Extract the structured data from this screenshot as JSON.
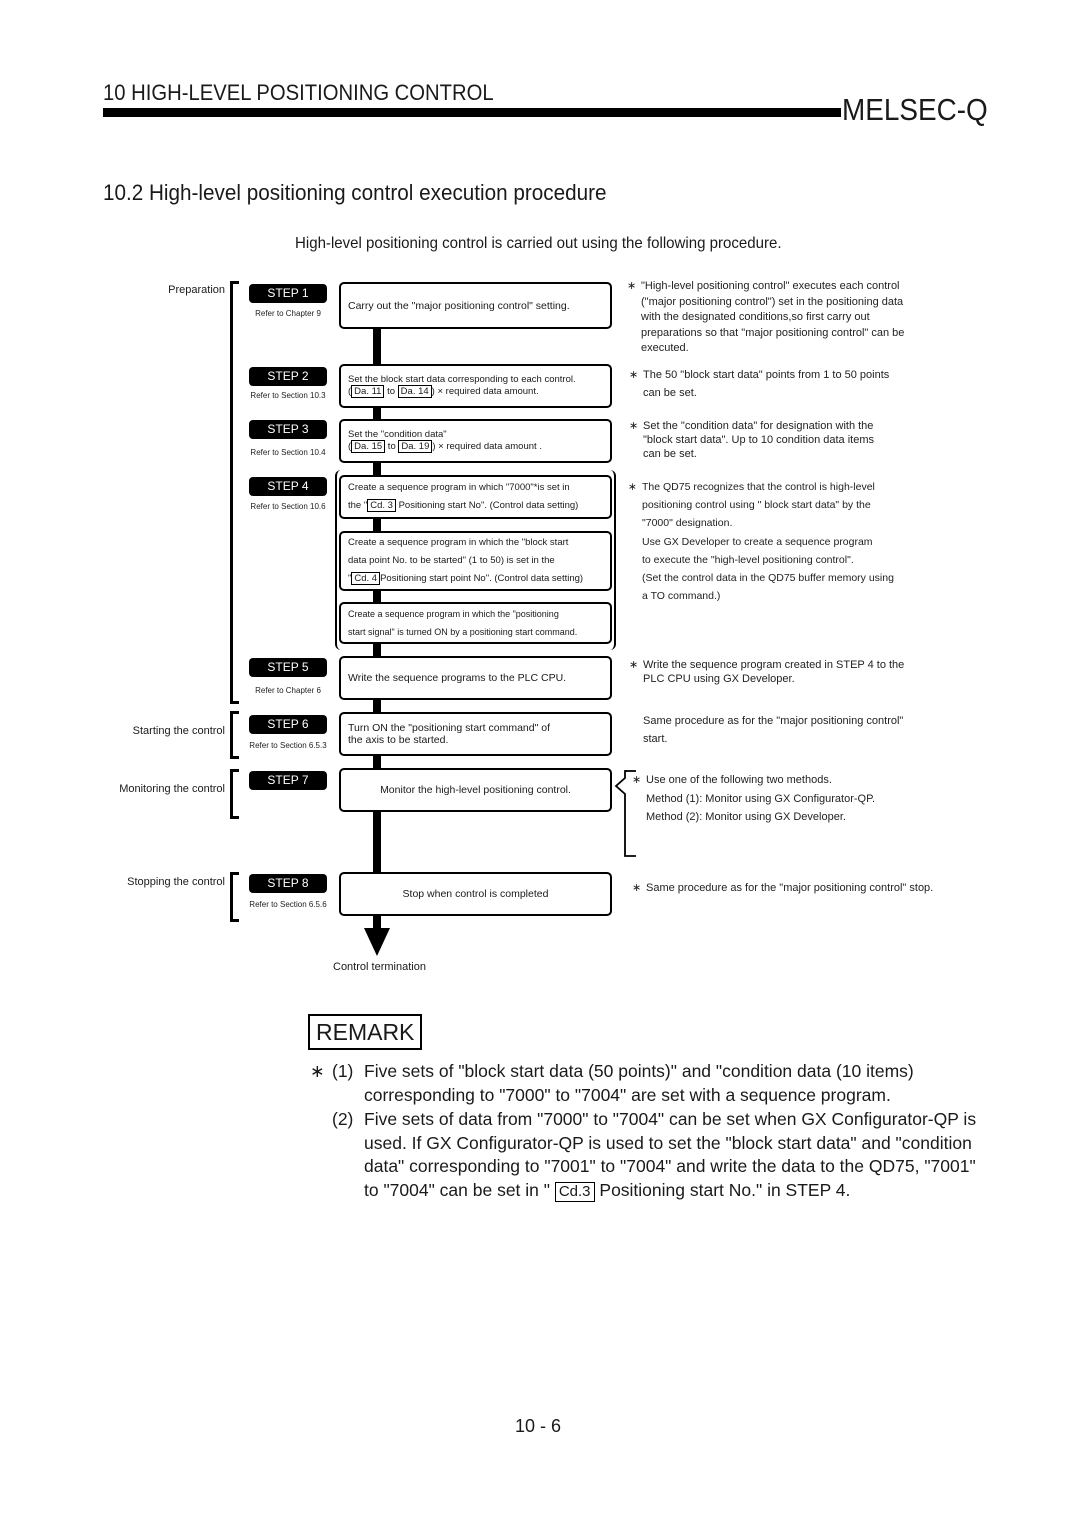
{
  "header": {
    "chapter_title": "10  HIGH-LEVEL POSITIONING CONTROL",
    "brand": "MELSEC-Q"
  },
  "section": {
    "title": "10.2 High-level positioning control execution procedure",
    "intro": "High-level positioning control is carried out using the following procedure."
  },
  "phases": {
    "preparation": "Preparation",
    "starting": "Starting the control",
    "monitoring": "Monitoring the control",
    "stopping": "Stopping the control"
  },
  "steps": [
    {
      "label": "STEP 1",
      "ref": "Refer to Chapter 9"
    },
    {
      "label": "STEP 2",
      "ref": "Refer to Section 10.3"
    },
    {
      "label": "STEP 3",
      "ref": "Refer to Section 10.4"
    },
    {
      "label": "STEP 4",
      "ref": "Refer to Section 10.6"
    },
    {
      "label": "STEP 5",
      "ref": "Refer to Chapter 6"
    },
    {
      "label": "STEP 6",
      "ref": "Refer to Section 6.5.3"
    },
    {
      "label": "STEP 7",
      "ref": ""
    },
    {
      "label": "STEP 8",
      "ref": "Refer to Section 6.5.6"
    }
  ],
  "boxes": {
    "step1": "Carry out the \"major positioning control\" setting.",
    "step2_line1": "Set the block start data corresponding to each control.",
    "step2_open": "(",
    "step2_tag_a": "Da. 11",
    "step2_to": " to ",
    "step2_tag_b": "Da. 14",
    "step2_tail": ") × required data amount.",
    "step3_line1": "Set the \"condition data\"",
    "step3_open": "(",
    "step3_tag_a": "Da. 15",
    "step3_to": " to ",
    "step3_tag_b": "Da. 19",
    "step3_tail": ") × required data amount .",
    "step4a_line1": "Create a sequence program in which \"7000\"*is set in",
    "step4a_pre": "the \"",
    "step4a_tag": "Cd. 3",
    "step4a_tail": " Positioning start No\". (Control data setting)",
    "step4b_line1": "Create a sequence program in which the \"block start",
    "step4b_line2": "data point No. to be started\" (1 to 50) is set in the",
    "step4b_pre": "\"",
    "step4b_tag": "Cd. 4",
    "step4b_tail": "Positioning start point No\". (Control data setting)",
    "step4c_line1": "Create a sequence program in which the \"positioning",
    "step4c_line2": "start signal\" is turned ON by a positioning start command.",
    "step5": "Write the sequence programs to the PLC CPU.",
    "step6_line1": "Turn ON the \"positioning start command\" of",
    "step6_line2": "the axis to be started.",
    "step7": "Monitor the high-level positioning control.",
    "step8": "Stop when control is completed",
    "termination": "Control termination"
  },
  "notes": {
    "asterisk": "∗",
    "n1": [
      "\"High-level positioning control\" executes each control",
      "(\"major positioning control\") set in the positioning data",
      "with the designated conditions,so first carry out",
      "preparations so that \"major positioning control\" can be",
      "executed."
    ],
    "n2": [
      "The 50 \"block start  data\" points from 1 to 50 points",
      "can be set."
    ],
    "n3": [
      "Set the \"condition data\" for designation with the",
      "\"block start  data\". Up to 10 condition data items",
      "can be set."
    ],
    "n4": [
      "The QD75 recognizes that the control is high-level",
      "positioning control using \" block start data\" by the",
      "\"7000\" designation.",
      "Use GX Developer to create a sequence program",
      "to execute the \"high-level positioning control\".",
      "(Set the control data in the QD75 buffer memory using",
      " a TO command.)"
    ],
    "n5": [
      "Write the sequence program created in STEP 4 to the",
      "PLC CPU using GX Developer."
    ],
    "n6": [
      "Same procedure as for the \"major positioning control\"",
      "start."
    ],
    "n7": [
      "Use one of the following two methods.",
      "Method (1): Monitor using GX Configurator-QP.",
      "Method (2): Monitor using GX Developer."
    ],
    "n8": [
      "Same procedure as for the \"major positioning control\" stop."
    ]
  },
  "remark": {
    "label": "REMARK",
    "star": "∗",
    "items": [
      {
        "num": "(1)",
        "text": "Five sets of \"block start data (50 points)\" and \"condition data (10 items) corresponding to \"7000\" to \"7004\" are set with a sequence program."
      },
      {
        "num": "(2)",
        "text_before": "Five sets of data from \"7000\" to \"7004\" can be set when GX Configurator-QP is used. If GX Configurator-QP is used to set the \"block start data\" and \"condition data\" corresponding to \"7001\" to \"7004\" and write the data to the QD75, \"7001\" to \"7004\" can be set in \" ",
        "tag": "Cd.3",
        "text_after": "  Positioning start No.\" in STEP 4."
      }
    ]
  },
  "footer": {
    "page_number": "10 - 6"
  }
}
